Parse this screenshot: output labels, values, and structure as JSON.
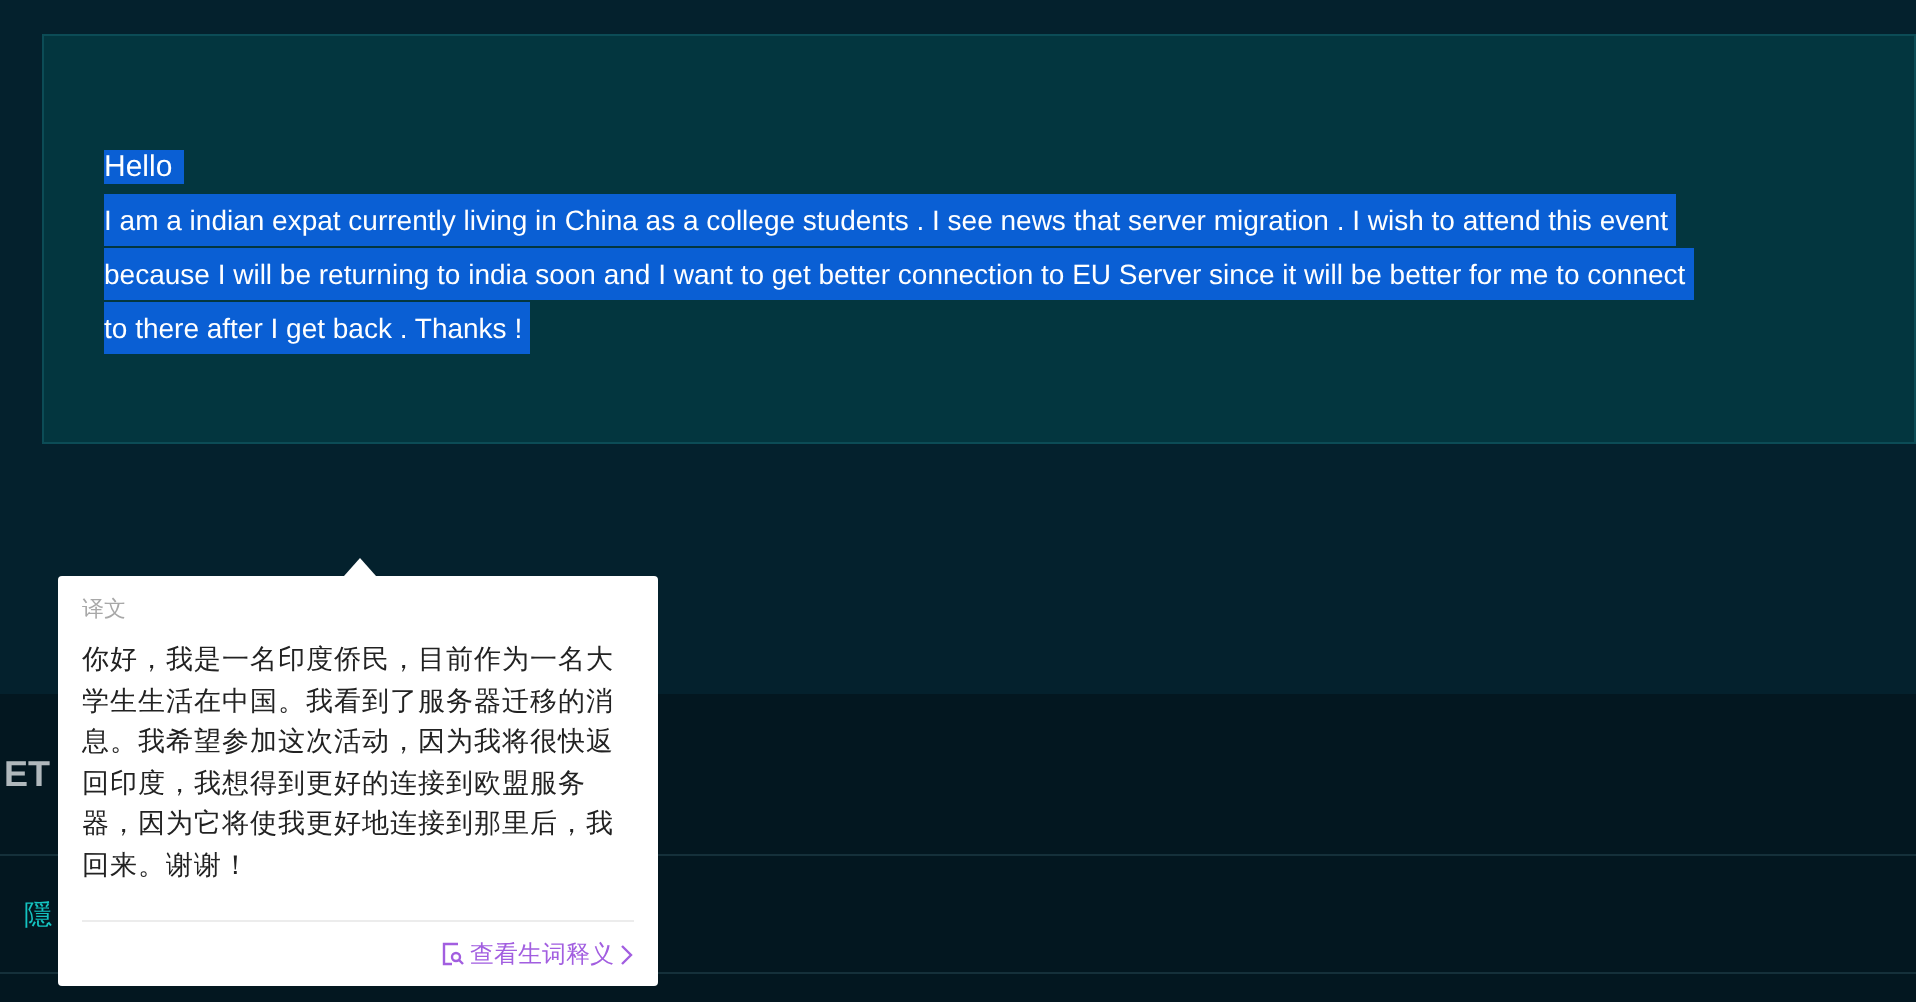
{
  "message": {
    "greeting": "Hello",
    "body_lines": [
      "I am a indian expat currently living in China as a college students . I see news that server migration . I wish to attend this event",
      "because I will be returning to india soon and I want to get better connection to EU Server since it will be better for me to connect",
      "to there after I get back . Thanks !"
    ],
    "selected": true
  },
  "background": {
    "heading": "ET",
    "link": "隱"
  },
  "translation_popup": {
    "label": "译文",
    "text": "你好，我是一名印度侨民，目前作为一名大学生生活在中国。我看到了服务器迁移的消息。我希望参加这次活动，因为我将很快返回印度，我想得到更好的连接到欧盟服务器，因为它将使我更好地连接到那里后，我回来。谢谢！",
    "footer_link": "查看生词释义"
  }
}
